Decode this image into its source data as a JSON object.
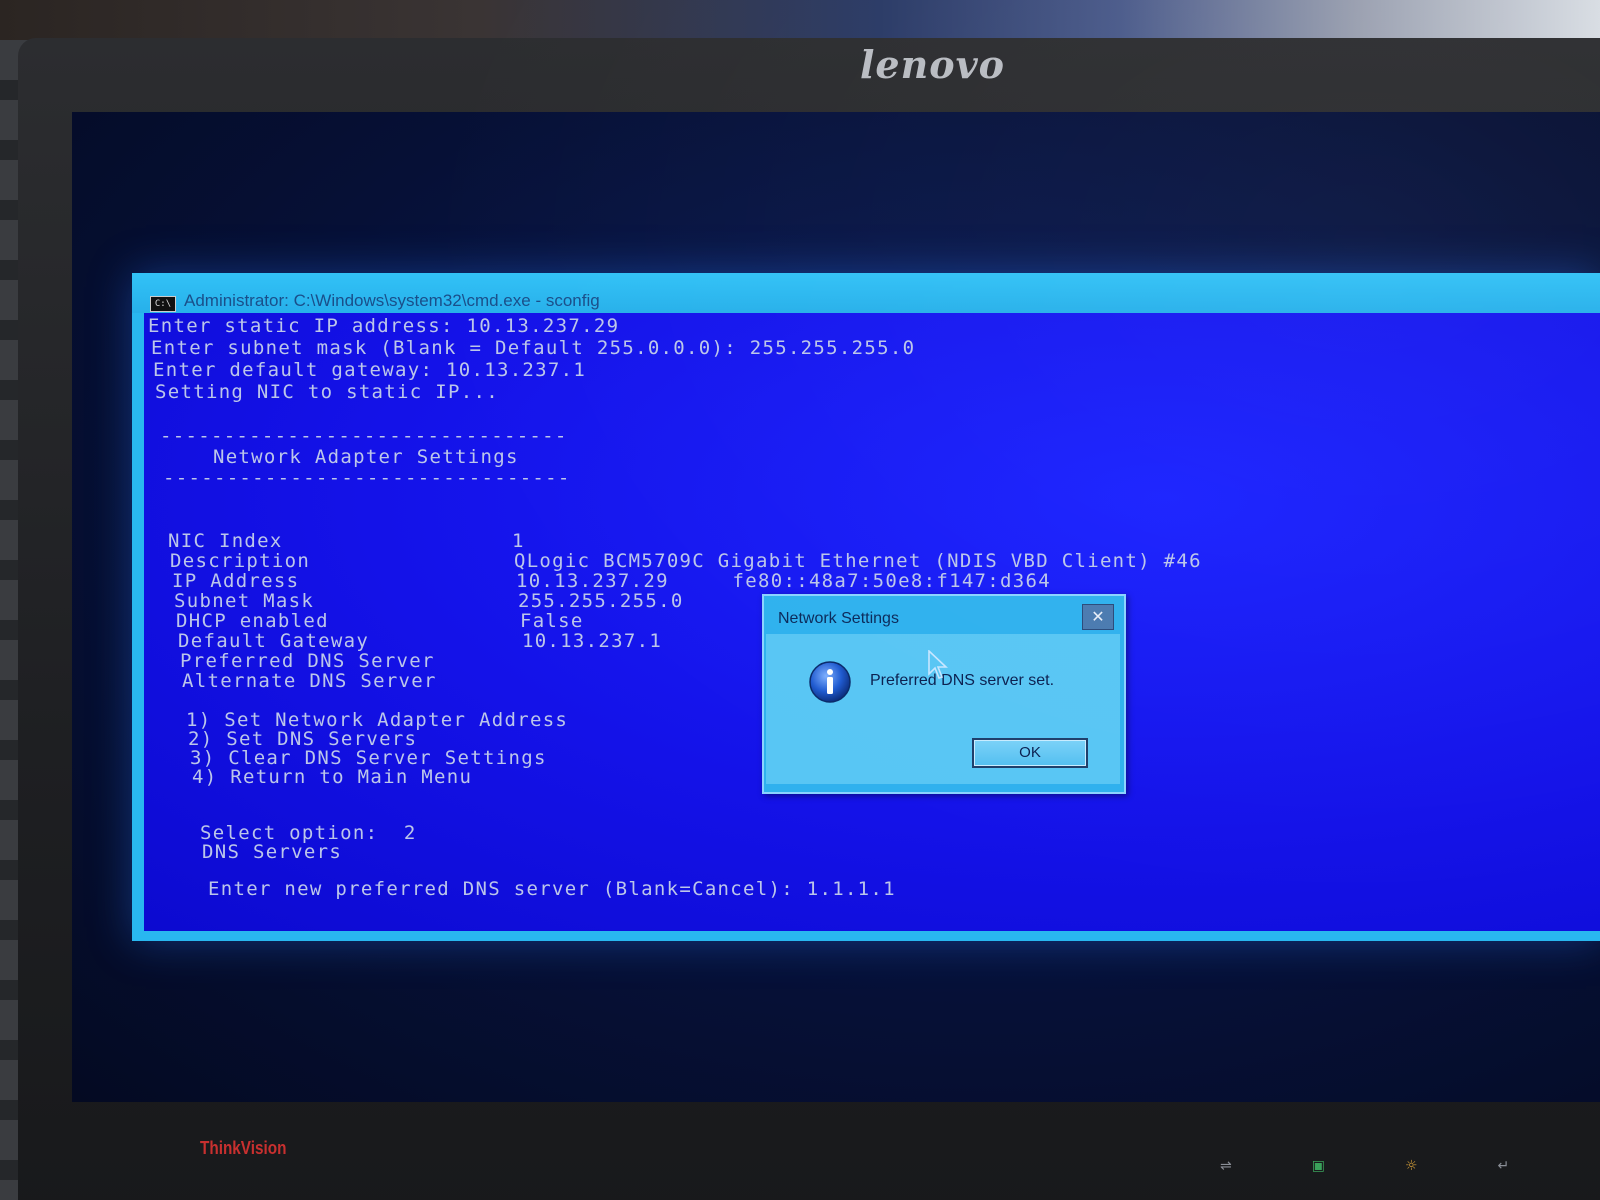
{
  "monitor": {
    "brand_logo": "lenovo",
    "bezel_brand": "ThinkVision"
  },
  "window": {
    "title": "Administrator: C:\\Windows\\system32\\cmd.exe - sconfig",
    "icon_label": "C:\\"
  },
  "console": {
    "lines": [
      "Enter static IP address: 10.13.237.29",
      "Enter subnet mask (Blank = Default 255.0.0.0): 255.255.255.0",
      "Enter default gateway: 10.13.237.1",
      "Setting NIC to static IP...",
      "--------------------------------",
      "    Network Adapter Settings",
      "--------------------------------",
      "NIC Index                  1",
      "Description                QLogic BCM5709C Gigabit Ethernet (NDIS VBD Client) #46",
      "IP Address                 10.13.237.29     fe80::48a7:50e8:f147:d364",
      "Subnet Mask                255.255.255.0",
      "DHCP enabled               False",
      "Default Gateway            10.13.237.1",
      "Preferred DNS Server",
      "Alternate DNS Server",
      "1) Set Network Adapter Address",
      "2) Set DNS Servers",
      "3) Clear DNS Server Settings",
      "4) Return to Main Menu",
      "Select option:  2",
      "DNS Servers",
      "Enter new preferred DNS server (Blank=Cancel): 1.1.1.1"
    ]
  },
  "dialog": {
    "title": "Network Settings",
    "message": "Preferred DNS server set.",
    "ok_label": "OK",
    "close_label": "✕",
    "icon": "info-icon"
  },
  "colors": {
    "console_bg": "#1412e8",
    "console_text": "#bcc6ea",
    "titlebar": "#29b7f0",
    "dialog_bg": "#58c6f4"
  }
}
